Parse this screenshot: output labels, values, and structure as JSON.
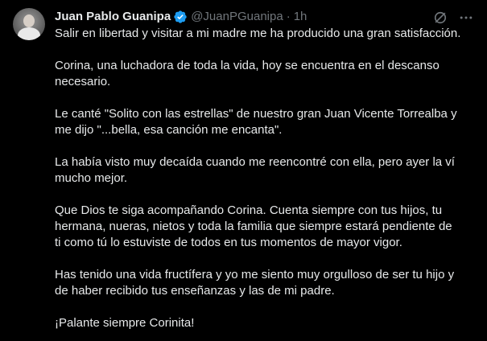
{
  "tweet": {
    "display_name": "Juan Pablo Guanipa",
    "handle": "@JuanPGuanipa",
    "separator": "·",
    "time": "1h",
    "paragraphs": [
      "Salir en libertad y visitar a mi madre me ha producido una gran satisfacción.",
      "Corina, una luchadora de toda la vida, hoy se encuentra en el descanso\nnecesario.",
      "Le canté \"Solito con las estrellas\" de nuestro gran Juan Vicente Torrealba y\nme dijo \"...bella, esa canción me encanta\".",
      "La había visto muy decaída cuando me reencontré con ella, pero ayer la ví\nmucho mejor.",
      "Que Dios te siga acompañando Corina. Cuenta siempre con tus hijos, tu\nhermana, nueras, nietos y toda la familia que siempre estará pendiente de\nti como tú lo estuviste de todos en tus momentos de mayor vigor.",
      "Has tenido una vida fructífera y yo me siento muy orgulloso de ser tu hijo y\nde haber recibido tus enseñanzas y las de mi padre.",
      "¡Palante siempre Corinita!"
    ]
  },
  "icons": {
    "verified": "verified-badge-icon",
    "grok": "grok-icon",
    "more": "more-options-icon"
  },
  "colors": {
    "background": "#000000",
    "text": "#e7e9ea",
    "muted": "#71767b",
    "verified": "#1d9bf0"
  }
}
